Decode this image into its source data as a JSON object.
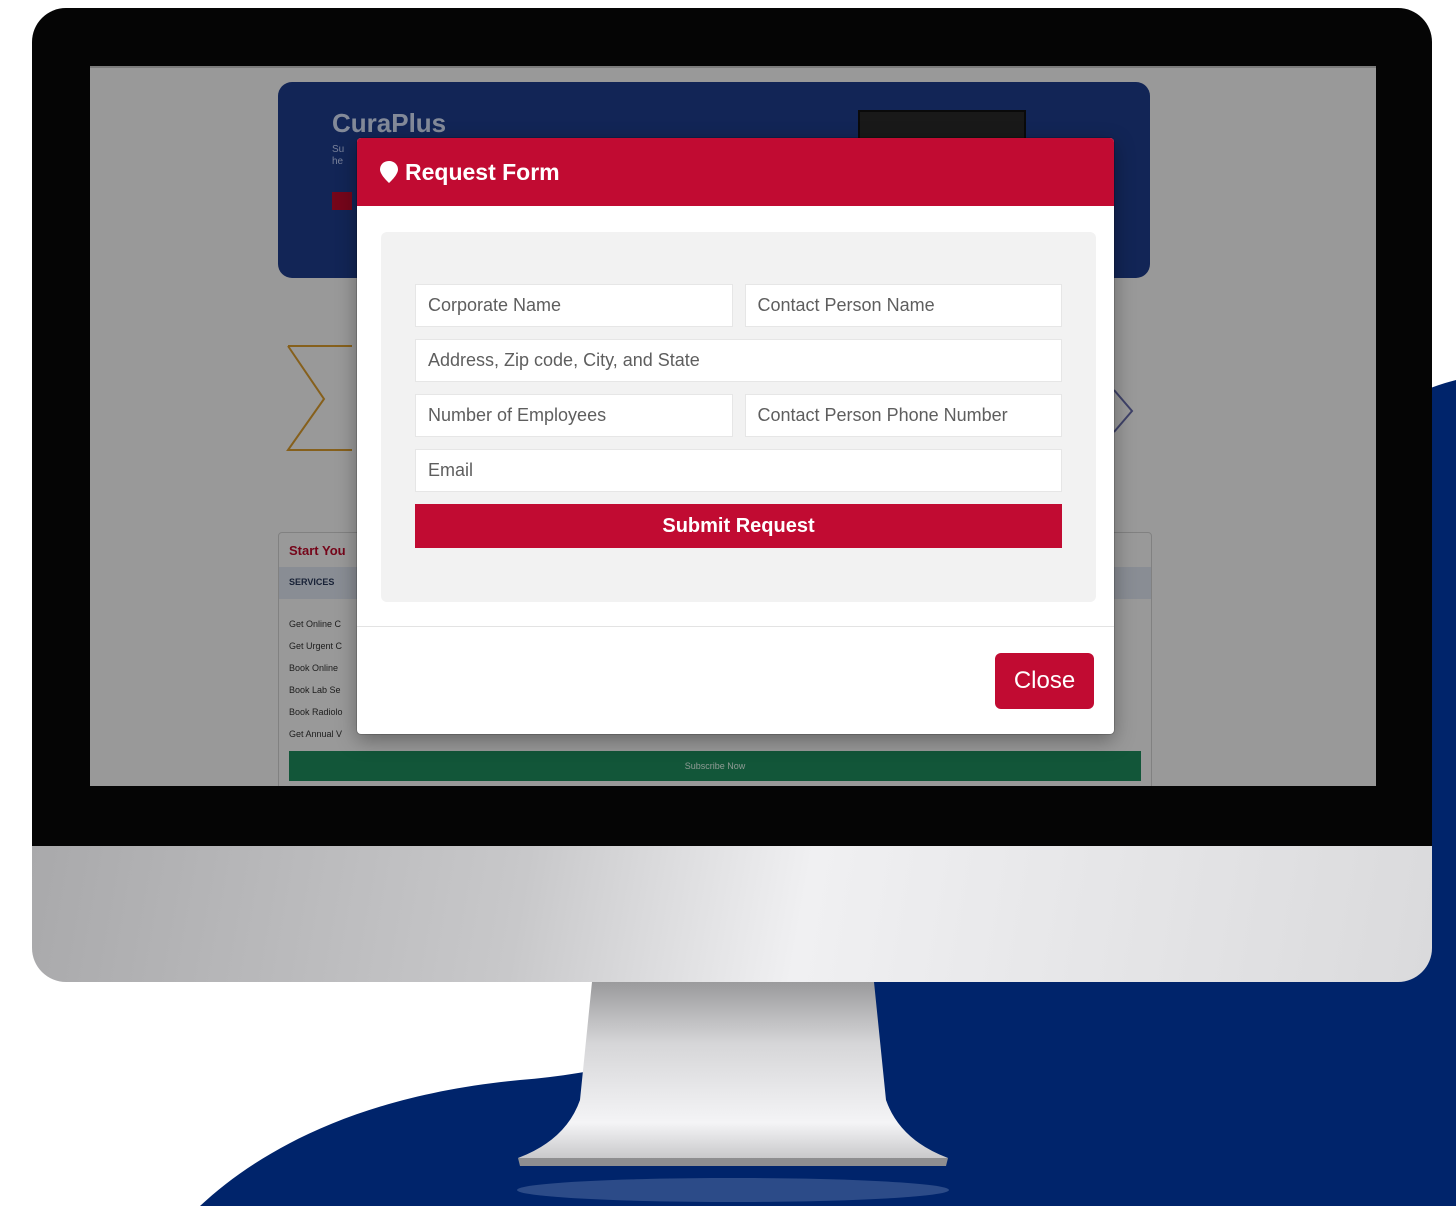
{
  "background": {
    "accent": "#00246b"
  },
  "site": {
    "brand": "CuraPlus",
    "banner_text_1": "Su",
    "banner_text_2": "he",
    "services_card": {
      "title": "Start You",
      "header": "SERVICES",
      "items": [
        "Get Online C",
        "Get Urgent C",
        "Book Online",
        "Book Lab Se",
        "Book Radiolo",
        "Get Annual V"
      ],
      "subscribe_label": "Subscribe Now"
    }
  },
  "modal": {
    "title": "Request Form",
    "icon": "map-pin-icon",
    "header_color": "#c10b32",
    "fields": {
      "corporate_name": "Corporate Name",
      "contact_person_name": "Contact Person Name",
      "address": "Address, Zip code, City, and State",
      "number_of_employees": "Number of Employees",
      "contact_person_phone": "Contact Person Phone Number",
      "email": "Email"
    },
    "submit_label": "Submit Request",
    "close_label": "Close"
  }
}
